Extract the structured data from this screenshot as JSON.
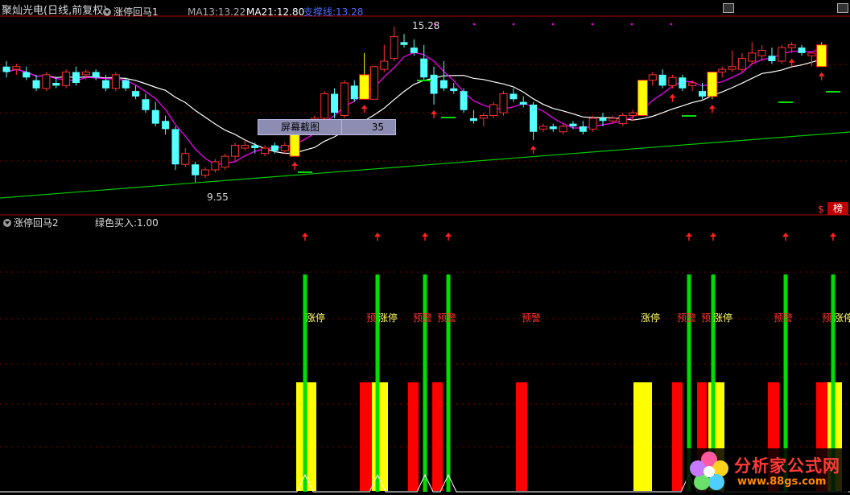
{
  "header": {
    "stock_name": "聚灿光电",
    "period": "(日线,前复权)",
    "indicator1": "涨停回马1",
    "ma13_label": "MA13:",
    "ma13_value": "13.22",
    "ma21_label": "MA21:",
    "ma21_value": "12.80",
    "support_label": "支撑线:",
    "support_value": "13.28"
  },
  "main_chart": {
    "high_label": "15.28",
    "low_label": "9.55",
    "screenshot_button": "屏幕截图",
    "tooltip_value": "35",
    "corner_label": "榜",
    "corner_mark": "$"
  },
  "sub_header": {
    "indicator2": "涨停回马2",
    "green_buy_label": "绿色买入:",
    "green_buy_value": "1.00"
  },
  "signals": {
    "limit_up": "涨停",
    "warning": "预警",
    "partial": "预"
  },
  "watermark": {
    "text": "分析家公式网",
    "url": "www.88gs.com"
  },
  "colors": {
    "up": "#ff3232",
    "down": "#54ffff",
    "yellow": "#ffff00",
    "green": "#00dd00",
    "red_bar": "#ff0000",
    "ma_white": "#ffffff",
    "ma_magenta": "#ff00ff",
    "support_green": "#00c800",
    "divider": "#aa0000"
  },
  "chart_data": {
    "type": "candlestick",
    "ylim": [
      9.2,
      15.6
    ],
    "candles": [
      [
        13.8,
        14.0,
        13.4,
        13.6
      ],
      [
        13.7,
        13.9,
        13.5,
        13.8
      ],
      [
        13.6,
        13.8,
        13.3,
        13.4
      ],
      [
        13.3,
        13.5,
        12.9,
        13.0
      ],
      [
        13.0,
        13.6,
        12.9,
        13.5
      ],
      [
        13.2,
        13.4,
        13.0,
        13.1
      ],
      [
        13.1,
        13.7,
        13.0,
        13.6
      ],
      [
        13.6,
        13.8,
        13.1,
        13.2
      ],
      [
        13.5,
        13.7,
        13.3,
        13.6
      ],
      [
        13.6,
        13.7,
        13.3,
        13.4
      ],
      [
        13.3,
        13.5,
        12.9,
        13.0
      ],
      [
        13.0,
        13.6,
        12.9,
        13.5
      ],
      [
        13.3,
        13.4,
        12.9,
        13.0
      ],
      [
        12.9,
        13.1,
        12.6,
        12.7
      ],
      [
        12.6,
        12.8,
        12.1,
        12.2
      ],
      [
        12.2,
        12.5,
        11.6,
        11.7
      ],
      [
        11.8,
        12.0,
        11.3,
        11.5
      ],
      [
        11.5,
        11.6,
        10.0,
        10.2
      ],
      [
        10.2,
        10.8,
        10.1,
        10.6
      ],
      [
        10.2,
        10.3,
        9.55,
        9.8
      ],
      [
        9.8,
        10.1,
        9.7,
        10.0
      ],
      [
        10.0,
        10.4,
        9.9,
        10.3
      ],
      [
        10.1,
        10.6,
        10.0,
        10.5
      ],
      [
        10.5,
        11.0,
        10.3,
        10.9
      ],
      [
        10.8,
        11.1,
        10.7,
        10.9
      ],
      [
        10.9,
        11.0,
        10.6,
        10.8
      ],
      [
        10.6,
        10.9,
        10.5,
        10.8
      ],
      [
        10.9,
        11.0,
        10.6,
        10.7
      ],
      [
        10.7,
        11.0,
        10.6,
        10.9
      ],
      [
        10.5,
        11.5,
        10.5,
        11.5
      ],
      [
        11.5,
        11.8,
        11.3,
        11.7
      ],
      [
        11.6,
        12.0,
        11.5,
        11.9
      ],
      [
        11.9,
        12.9,
        11.8,
        12.8
      ],
      [
        12.8,
        13.0,
        11.9,
        12.1
      ],
      [
        12.0,
        13.3,
        11.9,
        13.2
      ],
      [
        13.1,
        13.3,
        12.5,
        12.6
      ],
      [
        12.6,
        14.3,
        12.6,
        13.5
      ],
      [
        12.6,
        13.8,
        12.6,
        13.8
      ],
      [
        13.7,
        14.6,
        13.6,
        14.0
      ],
      [
        14.1,
        15.28,
        14.0,
        14.9
      ],
      [
        14.7,
        15.0,
        14.5,
        14.6
      ],
      [
        14.5,
        14.8,
        14.2,
        14.3
      ],
      [
        14.1,
        14.6,
        13.3,
        13.4
      ],
      [
        13.5,
        13.8,
        12.4,
        12.8
      ],
      [
        13.3,
        14.0,
        12.9,
        13.0
      ],
      [
        13.0,
        13.2,
        12.8,
        12.9
      ],
      [
        12.9,
        13.0,
        12.1,
        12.2
      ],
      [
        11.9,
        12.2,
        11.7,
        11.8
      ],
      [
        11.9,
        12.1,
        11.6,
        12.0
      ],
      [
        12.0,
        12.5,
        11.9,
        12.4
      ],
      [
        12.1,
        12.9,
        12.0,
        12.8
      ],
      [
        12.8,
        13.0,
        12.5,
        12.6
      ],
      [
        12.5,
        12.7,
        12.3,
        12.4
      ],
      [
        12.4,
        12.5,
        11.1,
        11.4
      ],
      [
        11.5,
        11.7,
        11.4,
        11.6
      ],
      [
        11.6,
        11.7,
        11.4,
        11.5
      ],
      [
        11.4,
        11.7,
        11.3,
        11.6
      ],
      [
        11.7,
        11.8,
        11.5,
        11.6
      ],
      [
        11.6,
        11.8,
        11.3,
        11.4
      ],
      [
        11.5,
        12.0,
        11.4,
        11.9
      ],
      [
        11.9,
        12.1,
        11.6,
        11.8
      ],
      [
        11.8,
        12.0,
        11.7,
        11.9
      ],
      [
        11.7,
        12.1,
        11.6,
        12.0
      ],
      [
        12.0,
        12.2,
        11.8,
        12.1
      ],
      [
        12.0,
        13.3,
        12.0,
        13.3
      ],
      [
        13.3,
        13.6,
        13.1,
        13.5
      ],
      [
        13.5,
        13.7,
        13.0,
        13.1
      ],
      [
        13.1,
        13.5,
        13.0,
        13.4
      ],
      [
        13.4,
        13.5,
        12.9,
        13.0
      ],
      [
        13.1,
        13.3,
        12.9,
        13.2
      ],
      [
        12.9,
        13.2,
        12.6,
        12.7
      ],
      [
        12.7,
        13.6,
        12.6,
        13.6
      ],
      [
        13.6,
        13.8,
        13.4,
        13.7
      ],
      [
        13.7,
        14.4,
        13.6,
        13.8
      ],
      [
        13.7,
        14.3,
        13.6,
        14.1
      ],
      [
        14.0,
        14.7,
        13.9,
        14.3
      ],
      [
        14.2,
        14.6,
        14.0,
        14.4
      ],
      [
        14.2,
        14.5,
        13.9,
        14.0
      ],
      [
        14.0,
        14.6,
        13.9,
        14.5
      ],
      [
        14.5,
        14.7,
        14.3,
        14.6
      ],
      [
        14.5,
        14.6,
        14.2,
        14.3
      ],
      [
        14.2,
        14.3,
        13.8,
        14.3
      ],
      [
        13.8,
        14.7,
        13.8,
        14.6
      ]
    ],
    "limit_up_indices": [
      29,
      36,
      64,
      71,
      82
    ],
    "red_arrow_indices": [
      29,
      36,
      43,
      53,
      67,
      71,
      79,
      82
    ],
    "green_signal_indices": [
      29,
      36,
      43,
      53,
      67,
      71,
      79,
      82
    ]
  }
}
